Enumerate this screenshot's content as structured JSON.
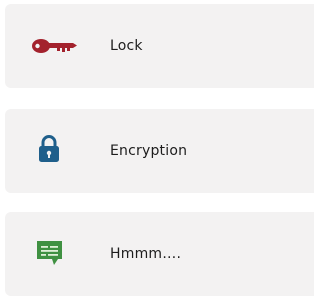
{
  "items": [
    {
      "label": "Lock",
      "icon": "key-icon",
      "color": "#a3222d"
    },
    {
      "label": "Encryption",
      "icon": "padlock-icon",
      "color": "#1f5f8b"
    },
    {
      "label": "Hmmm….",
      "icon": "chat-bubble-icon",
      "color": "#3f9142"
    }
  ]
}
